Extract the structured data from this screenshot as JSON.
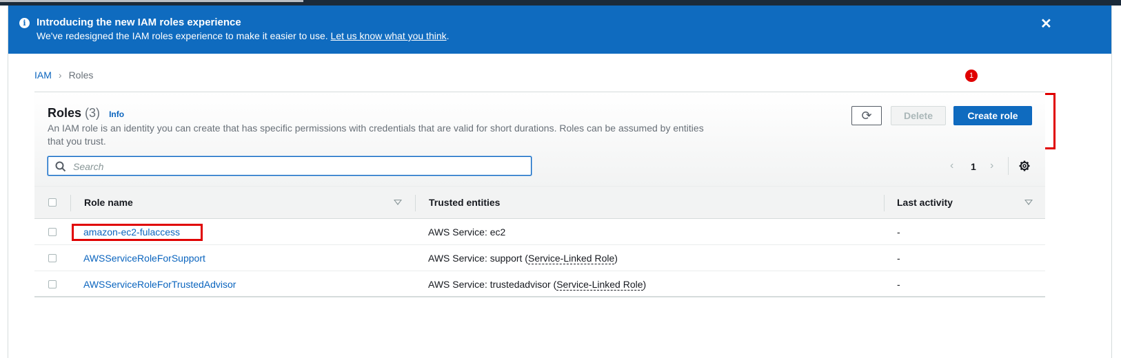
{
  "banner": {
    "title": "Introducing the new IAM roles experience",
    "description": "We've redesigned the IAM roles experience to make it easier to use.",
    "link_text": "Let us know what you think",
    "link_suffix": ".",
    "close_label": "✕"
  },
  "breadcrumb": {
    "root": "IAM",
    "current": "Roles"
  },
  "annotation": {
    "step_badge": "1"
  },
  "panel": {
    "title": "Roles",
    "count": "(3)",
    "info_label": "Info",
    "description": "An IAM role is an identity you can create that has specific permissions with credentials that are valid for short durations. Roles can be assumed by entities that you trust."
  },
  "toolbar": {
    "refresh_label": "⟳",
    "delete_label": "Delete",
    "create_label": "Create role"
  },
  "search": {
    "placeholder": "Search",
    "value": ""
  },
  "pagination": {
    "prev": "‹",
    "page": "1",
    "next": "›"
  },
  "table": {
    "columns": [
      "Role name",
      "Trusted entities",
      "Last activity"
    ],
    "rows": [
      {
        "role_name": "amazon-ec2-fulaccess",
        "trusted_prefix": "AWS Service: ec2",
        "trusted_suffix": "",
        "last_activity": "-"
      },
      {
        "role_name": "AWSServiceRoleForSupport",
        "trusted_prefix": "AWS Service: support (",
        "trusted_link": "Service-Linked Role",
        "trusted_suffix": ")",
        "last_activity": "-"
      },
      {
        "role_name": "AWSServiceRoleForTrustedAdvisor",
        "trusted_prefix": "AWS Service: trustedadvisor (",
        "trusted_link": "Service-Linked Role",
        "trusted_suffix": ")",
        "last_activity": "-"
      }
    ]
  },
  "colors": {
    "accent": "#0f6bbf",
    "link": "#0a64be",
    "annotation": "#e00000"
  }
}
